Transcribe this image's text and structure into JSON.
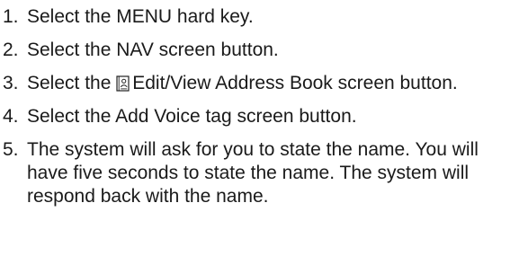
{
  "steps": [
    {
      "number": "1.",
      "text": "Select the MENU hard key."
    },
    {
      "number": "2.",
      "text": "Select the NAV screen button."
    },
    {
      "number": "3.",
      "text_before": "Select the ",
      "icon": "address-book-icon",
      "text_after": "Edit/View Address Book screen button."
    },
    {
      "number": "4.",
      "text": "Select the Add Voice tag screen button."
    },
    {
      "number": "5.",
      "text": "The system will ask for you to state the name. You will have five seconds to state the name. The system will respond back with the name."
    }
  ]
}
